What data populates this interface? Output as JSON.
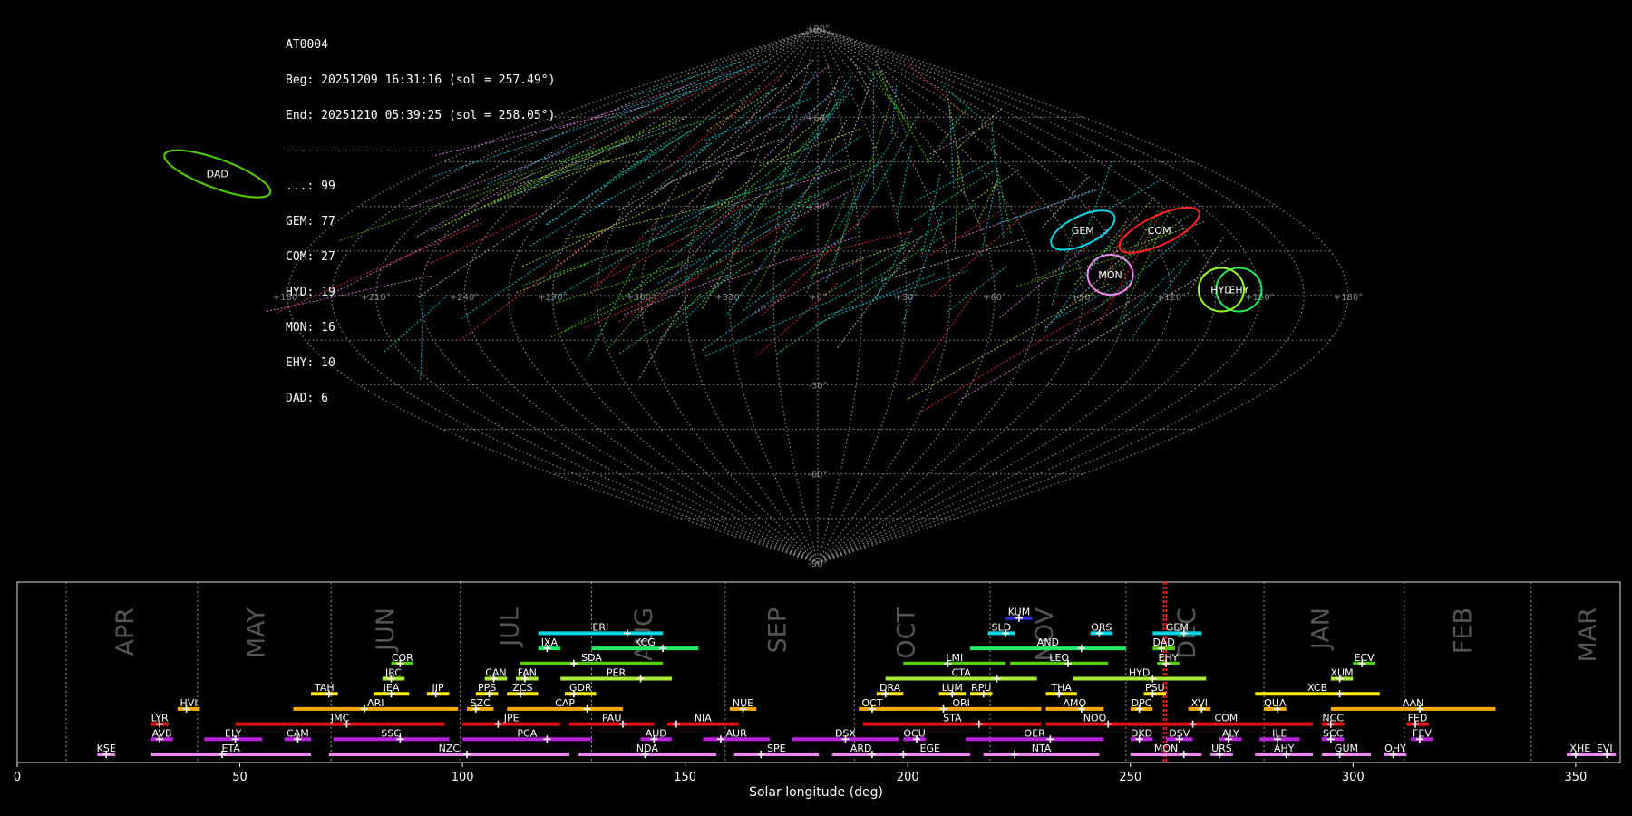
{
  "header": {
    "station": "AT0004",
    "beg": "Beg: 20251209 16:31:16 (sol = 257.49°)",
    "end": "End: 20251210 05:39:25 (sol = 258.05°)",
    "separator": "------------------------------------",
    "counts": [
      {
        "text": "...: 99"
      },
      {
        "text": "GEM: 77"
      },
      {
        "text": "COM: 27"
      },
      {
        "text": "HYD: 19"
      },
      {
        "text": "MON: 16"
      },
      {
        "text": "EHY: 10"
      },
      {
        "text": "DAD: 6"
      }
    ]
  },
  "sky_map": {
    "lon_ticks": [
      "+180°",
      "+150°",
      "+120°",
      "+90°",
      "+60°",
      "+30°",
      "+0°",
      "+330°",
      "+300°",
      "+270°",
      "+240°",
      "+210°",
      "+180°"
    ],
    "lat_ticks": [
      "+90°",
      "+60°",
      "+30°",
      "-30°",
      "-60°",
      "-90°"
    ],
    "radiants": [
      {
        "name": "COM",
        "lon": -125,
        "lat": 22,
        "color": "#ff2222"
      },
      {
        "name": "GEM",
        "lon": -97,
        "lat": 22,
        "color": "#00d8e8"
      },
      {
        "name": "DAD",
        "lon": 270,
        "lat": 41,
        "color": "#55d000"
      },
      {
        "name": "MON",
        "lon": -100,
        "lat": 7,
        "color": "#ee88ee"
      },
      {
        "name": "EHY",
        "lon": -143,
        "lat": 2,
        "color": "#22ee55"
      },
      {
        "name": "HYD",
        "lon": -137,
        "lat": 2,
        "color": "#99ff22"
      }
    ]
  },
  "chart_data": {
    "type": "timeline",
    "xlabel": "Solar longitude (deg)",
    "xlim": [
      0,
      360
    ],
    "xticks": [
      0,
      50,
      100,
      150,
      200,
      250,
      300,
      350
    ],
    "months": [
      {
        "name": "APR",
        "sol": 24.5
      },
      {
        "name": "MAY",
        "sol": 54
      },
      {
        "name": "JUN",
        "sol": 83
      },
      {
        "name": "JUL",
        "sol": 111
      },
      {
        "name": "AUG",
        "sol": 141
      },
      {
        "name": "SEP",
        "sol": 171
      },
      {
        "name": "OCT",
        "sol": 200
      },
      {
        "name": "NOV",
        "sol": 231
      },
      {
        "name": "DEC",
        "sol": 263
      },
      {
        "name": "JAN",
        "sol": 293
      },
      {
        "name": "FEB",
        "sol": 325
      },
      {
        "name": "MAR",
        "sol": 353
      }
    ],
    "month_boundaries": [
      11,
      40.5,
      70.5,
      99.5,
      129,
      159,
      188,
      218.5,
      249,
      280,
      311.5,
      340
    ],
    "current_sol": [
      257.49,
      258.05
    ],
    "showers": [
      {
        "code": "KUM",
        "start": 222,
        "end": 228,
        "peak": 225,
        "row": 9,
        "color": "#2a2ae0"
      },
      {
        "code": "ERI",
        "start": 117,
        "end": 145,
        "peak": 137,
        "row": 8,
        "color": "#00d8e8"
      },
      {
        "code": "SLD",
        "start": 218,
        "end": 224,
        "peak": 222,
        "row": 8,
        "color": "#00d8e8"
      },
      {
        "code": "ORS",
        "start": 241,
        "end": 246,
        "peak": 243,
        "row": 8,
        "color": "#00d8e8"
      },
      {
        "code": "GEM",
        "start": 255,
        "end": 266,
        "peak": 262,
        "row": 8,
        "color": "#00d8e8"
      },
      {
        "code": "IXA",
        "start": 117,
        "end": 122,
        "peak": 119,
        "row": 7,
        "color": "#22ee66"
      },
      {
        "code": "KCG",
        "start": 129,
        "end": 153,
        "peak": 145,
        "row": 7,
        "color": "#22ee66"
      },
      {
        "code": "AND",
        "start": 214,
        "end": 249,
        "peak": 239,
        "row": 7,
        "color": "#22ee66"
      },
      {
        "code": "DAD",
        "start": 255,
        "end": 260,
        "peak": 257,
        "row": 7,
        "color": "#55d000"
      },
      {
        "code": "COR",
        "start": 84,
        "end": 89,
        "peak": 86,
        "row": 6,
        "color": "#55d000"
      },
      {
        "code": "SDA",
        "start": 113,
        "end": 145,
        "peak": 125,
        "row": 6,
        "color": "#55d000"
      },
      {
        "code": "LMI",
        "start": 199,
        "end": 222,
        "peak": 209,
        "row": 6,
        "color": "#55d000"
      },
      {
        "code": "LEO",
        "start": 223,
        "end": 245,
        "peak": 236,
        "row": 6,
        "color": "#55d000"
      },
      {
        "code": "EHY",
        "start": 256,
        "end": 261,
        "peak": 258,
        "row": 6,
        "color": "#55d000"
      },
      {
        "code": "ECV",
        "start": 300,
        "end": 305,
        "peak": 302,
        "row": 6,
        "color": "#55d000"
      },
      {
        "code": "JRC",
        "start": 82,
        "end": 87,
        "peak": 84,
        "row": 5,
        "color": "#aaee33"
      },
      {
        "code": "CAN",
        "start": 105,
        "end": 110,
        "peak": 107,
        "row": 5,
        "color": "#aaee33"
      },
      {
        "code": "FAN",
        "start": 112,
        "end": 117,
        "peak": 114,
        "row": 5,
        "color": "#aaee33"
      },
      {
        "code": "PER",
        "start": 122,
        "end": 147,
        "peak": 140,
        "row": 5,
        "color": "#aaee33"
      },
      {
        "code": "CTA",
        "start": 195,
        "end": 229,
        "peak": 220,
        "row": 5,
        "color": "#aaee33"
      },
      {
        "code": "HYD",
        "start": 237,
        "end": 267,
        "peak": 255,
        "row": 5,
        "color": "#aaee33"
      },
      {
        "code": "XUM",
        "start": 295,
        "end": 300,
        "peak": 297,
        "row": 5,
        "color": "#aaee33"
      },
      {
        "code": "TAH",
        "start": 66,
        "end": 72,
        "peak": 70,
        "row": 4,
        "color": "#ffee00"
      },
      {
        "code": "JEA",
        "start": 80,
        "end": 88,
        "peak": 84,
        "row": 4,
        "color": "#ffee00"
      },
      {
        "code": "JIP",
        "start": 92,
        "end": 97,
        "peak": 94,
        "row": 4,
        "color": "#ffee00"
      },
      {
        "code": "PPS",
        "start": 103,
        "end": 108,
        "peak": 106,
        "row": 4,
        "color": "#ffee00"
      },
      {
        "code": "ZCS",
        "start": 110,
        "end": 117,
        "peak": 113,
        "row": 4,
        "color": "#ffee00"
      },
      {
        "code": "GDR",
        "start": 123,
        "end": 130,
        "peak": 125,
        "row": 4,
        "color": "#ffee00"
      },
      {
        "code": "DRA",
        "start": 193,
        "end": 199,
        "peak": 195,
        "row": 4,
        "color": "#ffee00"
      },
      {
        "code": "LUM",
        "start": 207,
        "end": 213,
        "peak": 210,
        "row": 4,
        "color": "#ffee00"
      },
      {
        "code": "RPU",
        "start": 214,
        "end": 219,
        "peak": 217,
        "row": 4,
        "color": "#ffee00"
      },
      {
        "code": "THA",
        "start": 231,
        "end": 238,
        "peak": 234,
        "row": 4,
        "color": "#ffee00"
      },
      {
        "code": "PSU",
        "start": 253,
        "end": 258,
        "peak": 255,
        "row": 4,
        "color": "#ffee00"
      },
      {
        "code": "XCB",
        "start": 278,
        "end": 306,
        "peak": 297,
        "row": 4,
        "color": "#ffee00"
      },
      {
        "code": "HVI",
        "start": 36,
        "end": 41,
        "peak": 38,
        "row": 3,
        "color": "#ffaa00"
      },
      {
        "code": "ARI",
        "start": 62,
        "end": 99,
        "peak": 78,
        "row": 3,
        "color": "#ffaa00"
      },
      {
        "code": "SZC",
        "start": 101,
        "end": 107,
        "peak": 103,
        "row": 3,
        "color": "#ffaa00"
      },
      {
        "code": "CAP",
        "start": 110,
        "end": 136,
        "peak": 128,
        "row": 3,
        "color": "#ffaa00"
      },
      {
        "code": "NUE",
        "start": 160,
        "end": 166,
        "peak": 163,
        "row": 3,
        "color": "#ffaa00"
      },
      {
        "code": "OCT",
        "start": 189,
        "end": 195,
        "peak": 192,
        "row": 3,
        "color": "#ffaa00"
      },
      {
        "code": "ORI",
        "start": 194,
        "end": 230,
        "peak": 208,
        "row": 3,
        "color": "#ffaa00"
      },
      {
        "code": "AMO",
        "start": 231,
        "end": 244,
        "peak": 239,
        "row": 3,
        "color": "#ffaa00"
      },
      {
        "code": "DPC",
        "start": 250,
        "end": 255,
        "peak": 252,
        "row": 3,
        "color": "#ffaa00"
      },
      {
        "code": "XVI",
        "start": 263,
        "end": 268,
        "peak": 266,
        "row": 3,
        "color": "#ffaa00"
      },
      {
        "code": "QUA",
        "start": 280,
        "end": 285,
        "peak": 283,
        "row": 3,
        "color": "#ffaa00"
      },
      {
        "code": "AAN",
        "start": 295,
        "end": 332,
        "peak": 315,
        "row": 3,
        "color": "#ffaa00"
      },
      {
        "code": "LYR",
        "start": 30,
        "end": 34,
        "peak": 32,
        "row": 2,
        "color": "#ee1111"
      },
      {
        "code": "JMC",
        "start": 49,
        "end": 96,
        "peak": 74,
        "row": 2,
        "color": "#ee1111"
      },
      {
        "code": "JPE",
        "start": 100,
        "end": 122,
        "peak": 108,
        "row": 2,
        "color": "#ee1111"
      },
      {
        "code": "PAU",
        "start": 124,
        "end": 143,
        "peak": 136,
        "row": 2,
        "color": "#ee1111"
      },
      {
        "code": "NIA",
        "start": 146,
        "end": 162,
        "peak": 148,
        "row": 2,
        "color": "#ee1111"
      },
      {
        "code": "STA",
        "start": 190,
        "end": 230,
        "peak": 216,
        "row": 2,
        "color": "#ee1111"
      },
      {
        "code": "NOO",
        "start": 231,
        "end": 253,
        "peak": 245,
        "row": 2,
        "color": "#ee1111"
      },
      {
        "code": "COM",
        "start": 252,
        "end": 291,
        "peak": 264,
        "row": 2,
        "color": "#ee1111"
      },
      {
        "code": "NCC",
        "start": 293,
        "end": 298,
        "peak": 295,
        "row": 2,
        "color": "#ee1111"
      },
      {
        "code": "FED",
        "start": 312,
        "end": 317,
        "peak": 314,
        "row": 2,
        "color": "#ee1111"
      },
      {
        "code": "AVB",
        "start": 30,
        "end": 35,
        "peak": 32,
        "row": 1,
        "color": "#bb22dd"
      },
      {
        "code": "ELY",
        "start": 42,
        "end": 55,
        "peak": 49,
        "row": 1,
        "color": "#bb22dd"
      },
      {
        "code": "CAM",
        "start": 60,
        "end": 66,
        "peak": 63,
        "row": 1,
        "color": "#bb22dd"
      },
      {
        "code": "SSG",
        "start": 71,
        "end": 97,
        "peak": 86,
        "row": 1,
        "color": "#bb22dd"
      },
      {
        "code": "PCA",
        "start": 100,
        "end": 129,
        "peak": 119,
        "row": 1,
        "color": "#bb22dd"
      },
      {
        "code": "AUD",
        "start": 140,
        "end": 147,
        "peak": 143,
        "row": 1,
        "color": "#bb22dd"
      },
      {
        "code": "AUR",
        "start": 154,
        "end": 169,
        "peak": 158,
        "row": 1,
        "color": "#bb22dd"
      },
      {
        "code": "DSX",
        "start": 174,
        "end": 198,
        "peak": 186,
        "row": 1,
        "color": "#bb22dd"
      },
      {
        "code": "OCU",
        "start": 199,
        "end": 204,
        "peak": 202,
        "row": 1,
        "color": "#bb22dd"
      },
      {
        "code": "OER",
        "start": 213,
        "end": 244,
        "peak": 232,
        "row": 1,
        "color": "#bb22dd"
      },
      {
        "code": "DKD",
        "start": 250,
        "end": 255,
        "peak": 252,
        "row": 1,
        "color": "#bb22dd"
      },
      {
        "code": "DSV",
        "start": 258,
        "end": 264,
        "peak": 261,
        "row": 1,
        "color": "#bb22dd"
      },
      {
        "code": "ALY",
        "start": 270,
        "end": 275,
        "peak": 272,
        "row": 1,
        "color": "#bb22dd"
      },
      {
        "code": "ILE",
        "start": 279,
        "end": 288,
        "peak": 283,
        "row": 1,
        "color": "#bb22dd"
      },
      {
        "code": "SCC",
        "start": 293,
        "end": 298,
        "peak": 295,
        "row": 1,
        "color": "#bb22dd"
      },
      {
        "code": "FEV",
        "start": 313,
        "end": 318,
        "peak": 315,
        "row": 1,
        "color": "#bb22dd"
      },
      {
        "code": "KSE",
        "start": 18,
        "end": 22,
        "peak": 20,
        "row": 0,
        "color": "#ee88ee"
      },
      {
        "code": "ETA",
        "start": 30,
        "end": 66,
        "peak": 46,
        "row": 0,
        "color": "#ee88ee"
      },
      {
        "code": "NZC",
        "start": 70,
        "end": 124,
        "peak": 101,
        "row": 0,
        "color": "#ee88ee"
      },
      {
        "code": "NDA",
        "start": 126,
        "end": 157,
        "peak": 141,
        "row": 0,
        "color": "#ee88ee"
      },
      {
        "code": "SPE",
        "start": 161,
        "end": 180,
        "peak": 167,
        "row": 0,
        "color": "#ee88ee"
      },
      {
        "code": "ARD",
        "start": 183,
        "end": 196,
        "peak": 192,
        "row": 0,
        "color": "#ee88ee"
      },
      {
        "code": "EGE",
        "start": 196,
        "end": 214,
        "peak": 199,
        "row": 0,
        "color": "#ee88ee"
      },
      {
        "code": "NTA",
        "start": 217,
        "end": 243,
        "peak": 224,
        "row": 0,
        "color": "#ee88ee"
      },
      {
        "code": "MON",
        "start": 250,
        "end": 266,
        "peak": 262,
        "row": 0,
        "color": "#ee88ee"
      },
      {
        "code": "URS",
        "start": 268,
        "end": 273,
        "peak": 270,
        "row": 0,
        "color": "#ee88ee"
      },
      {
        "code": "AHY",
        "start": 278,
        "end": 291,
        "peak": 285,
        "row": 0,
        "color": "#ee88ee"
      },
      {
        "code": "GUM",
        "start": 293,
        "end": 304,
        "peak": 297,
        "row": 0,
        "color": "#ee88ee"
      },
      {
        "code": "OHY",
        "start": 307,
        "end": 312,
        "peak": 309,
        "row": 0,
        "color": "#ee88ee"
      },
      {
        "code": "XHE",
        "start": 348,
        "end": 354,
        "peak": 350,
        "row": 0,
        "color": "#ee88ee"
      },
      {
        "code": "EVI",
        "start": 354,
        "end": 359,
        "peak": 357,
        "row": 0,
        "color": "#ee88ee"
      }
    ]
  }
}
